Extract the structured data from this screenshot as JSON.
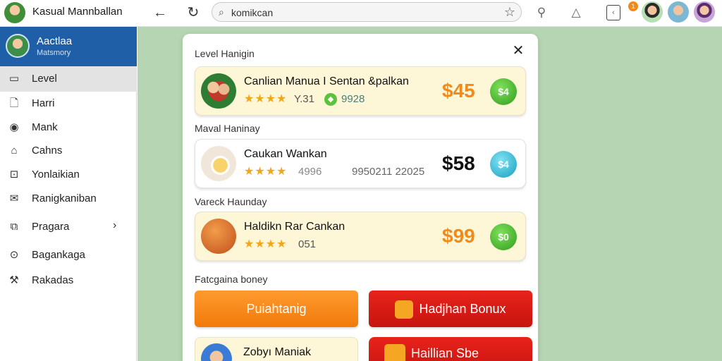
{
  "app": {
    "title": "Kasual Mannballan"
  },
  "search": {
    "value": "komikcan"
  },
  "toolbar": {
    "notification_count": "1"
  },
  "profile": {
    "name": "Aactlaa",
    "subtitle": "Matsmory"
  },
  "sidebar": {
    "items": [
      {
        "label": "Level",
        "icon": "window-icon",
        "active": true
      },
      {
        "label": "Harri",
        "icon": "document-icon"
      },
      {
        "label": "Mank",
        "icon": "eye-icon"
      },
      {
        "label": "Cahns",
        "icon": "home-icon"
      },
      {
        "label": "Yonlaikian",
        "icon": "camera-icon"
      },
      {
        "label": "Ranigkaniban",
        "icon": "mail-icon"
      },
      {
        "label": "Pragara",
        "icon": "puzzle-icon",
        "has_submenu": true
      },
      {
        "label": "Bagankaga",
        "icon": "target-icon"
      },
      {
        "label": "Rakadas",
        "icon": "wrench-icon"
      }
    ]
  },
  "modal": {
    "sections": [
      "Level Hanigin",
      "Maval Haninay",
      "Vareck Haunday",
      "Fatcgaina boney"
    ],
    "cards": [
      {
        "title": "Canlian Manua I Sentan &palkan",
        "stars": "★★★★",
        "rating": "Y.31",
        "badge": "◆",
        "count": "9928",
        "price": "$45",
        "pill": "$4",
        "variant": "yellow"
      },
      {
        "title": "Caukan Wankan",
        "stars": "★★★★",
        "rating": "4996",
        "count": "9950211 22025",
        "price": "$58",
        "pill": "$4",
        "variant": "white"
      },
      {
        "title": "Haldikn Rar Cankan",
        "stars": "★★★★",
        "rating": "051",
        "price": "$99",
        "pill": "$0",
        "variant": "yellow"
      }
    ],
    "buttons": [
      {
        "label": "Puiahtanig"
      },
      {
        "label": "Hadjhan Bonux"
      }
    ],
    "bottom_items": [
      {
        "label": "Zobyı Maniak"
      },
      {
        "label": "Haillian Sbe"
      }
    ]
  },
  "colors": {
    "sidebar_profile_bg": "#1f5fa8",
    "background": "#b6d5b2",
    "price_orange": "#f08a1c",
    "button_orange": "#f7891a",
    "button_red": "#d81b14",
    "pill_green": "#3fae22",
    "pill_blue": "#24aed0"
  }
}
